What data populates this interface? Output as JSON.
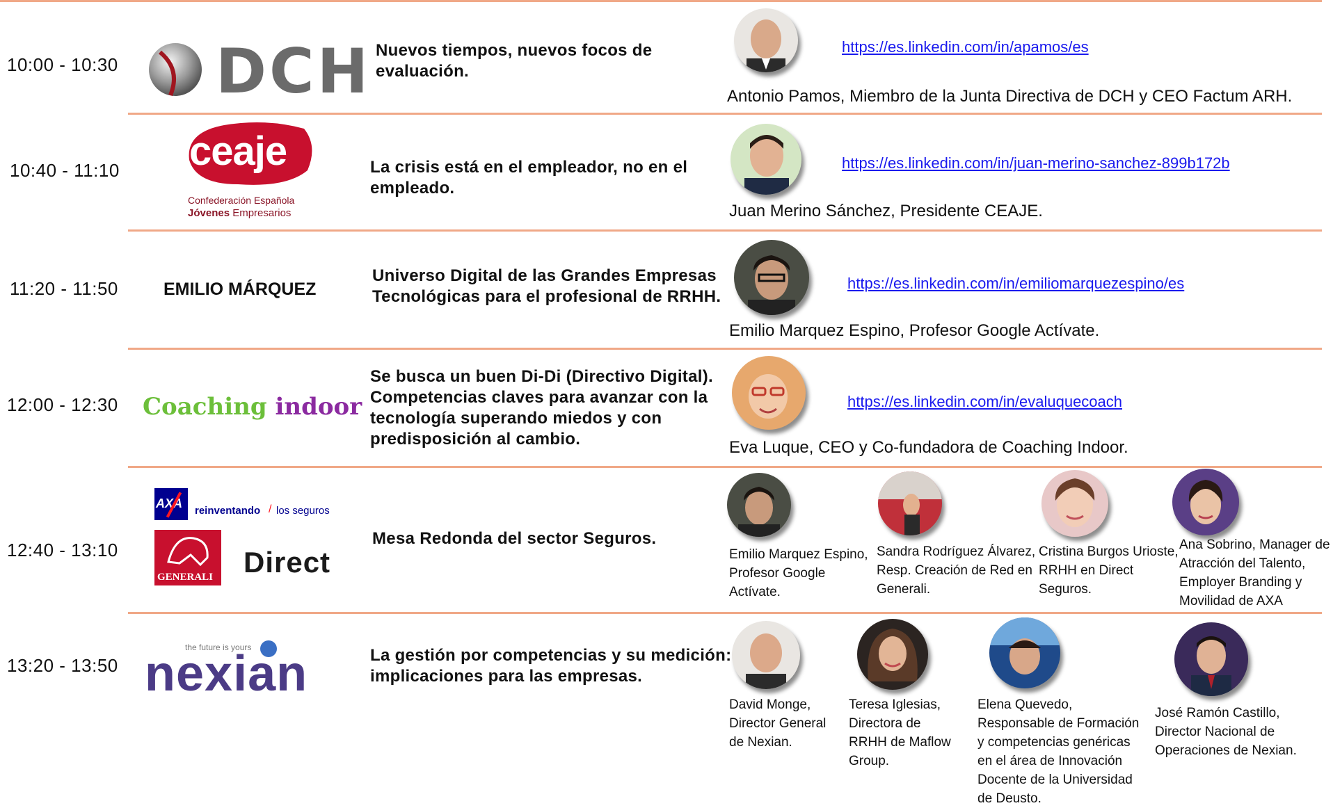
{
  "colors": {
    "divider": "#f0a887",
    "link": "#1a1aee",
    "dch_gray": "#6b6b6b",
    "ceaje_red": "#c8102e",
    "ceaje_dark": "#8a1527",
    "coaching_green": "#6cbf3a",
    "coaching_purple": "#8b2aa0",
    "nexian_purple": "#4b3b86",
    "axa_blue": "#00008f",
    "generali_red": "#c8102e"
  },
  "rows": [
    {
      "time": "10:00 - 10:30",
      "logo": {
        "text": "DCH"
      },
      "topic": [
        "Nuevos tiempos, nuevos focos de",
        "evaluación."
      ],
      "link": "https://es.linkedin.com/in/apamos/es",
      "caption": "Antonio Pamos, Miembro de la Junta Directiva de DCH y CEO Factum ARH."
    },
    {
      "time": "10:40 - 11:10",
      "logo": {
        "text": "ceaje",
        "line1": "Confederación Española",
        "line2_bold": "Jóvenes",
        "line2_rest": " Empresarios"
      },
      "topic": [
        "La crisis está en el empleador, no en el",
        "empleado."
      ],
      "link": "https://es.linkedin.com/in/juan-merino-sanchez-899b172b",
      "caption": "Juan Merino Sánchez, Presidente CEAJE."
    },
    {
      "time": "11:20 - 11:50",
      "logo": {
        "text": "EMILIO MÁRQUEZ"
      },
      "topic": [
        "Universo Digital de las Grandes Empresas",
        "Tecnológicas para el profesional de RRHH."
      ],
      "link": "https://es.linkedin.com/in/emiliomarquezespino/es",
      "caption": "Emilio Marquez Espino, Profesor Google Actívate."
    },
    {
      "time": "12:00 - 12:30",
      "logo": {
        "word1": "Coaching",
        "word2": "indoor"
      },
      "topic": [
        "Se busca un buen Di-Di (Directivo Digital).",
        "Competencias claves para avanzar con la",
        "tecnología superando miedos y con",
        "predisposición al cambio."
      ],
      "link": "https://es.linkedin.com/in/evaluquecoach",
      "caption": "Eva Luque, CEO y Co-fundadora de Coaching Indoor."
    },
    {
      "time": "12:40 - 13:10",
      "logo": {
        "axa": "AXA",
        "axa_tag1": "reinventando",
        "axa_tag2": "los seguros",
        "generali": "GENERALI",
        "direct": "Direct"
      },
      "topic": [
        "Mesa Redonda del sector Seguros."
      ],
      "speakers": [
        {
          "lines": [
            "Emilio Marquez Espino,",
            "Profesor Google",
            "Actívate."
          ]
        },
        {
          "lines": [
            "Sandra Rodríguez Álvarez,",
            "Resp. Creación de Red en",
            "Generali."
          ]
        },
        {
          "lines": [
            "Cristina Burgos Urioste,",
            "RRHH en Direct",
            "Seguros."
          ]
        },
        {
          "lines": [
            "Ana Sobrino, Manager de",
            "Atracción del Talento,",
            "Employer Branding y",
            "Movilidad de AXA"
          ]
        }
      ]
    },
    {
      "time": "13:20 - 13:50",
      "logo": {
        "tagline": "the future is yours",
        "text": "nexian"
      },
      "topic": [
        "La gestión por competencias y su medición:",
        "implicaciones para las empresas."
      ],
      "speakers": [
        {
          "lines": [
            "David Monge,",
            "Director General",
            "de Nexian."
          ]
        },
        {
          "lines": [
            "Teresa Iglesias,",
            "Directora de",
            "RRHH de Maflow",
            "Group."
          ]
        },
        {
          "lines": [
            "Elena Quevedo,",
            "Responsable de Formación",
            "y competencias genéricas",
            "en el área de Innovación",
            "Docente de la Universidad",
            "de Deusto."
          ]
        },
        {
          "lines": [
            "José Ramón Castillo,",
            "Director Nacional de",
            "Operaciones de Nexian."
          ]
        }
      ]
    }
  ]
}
